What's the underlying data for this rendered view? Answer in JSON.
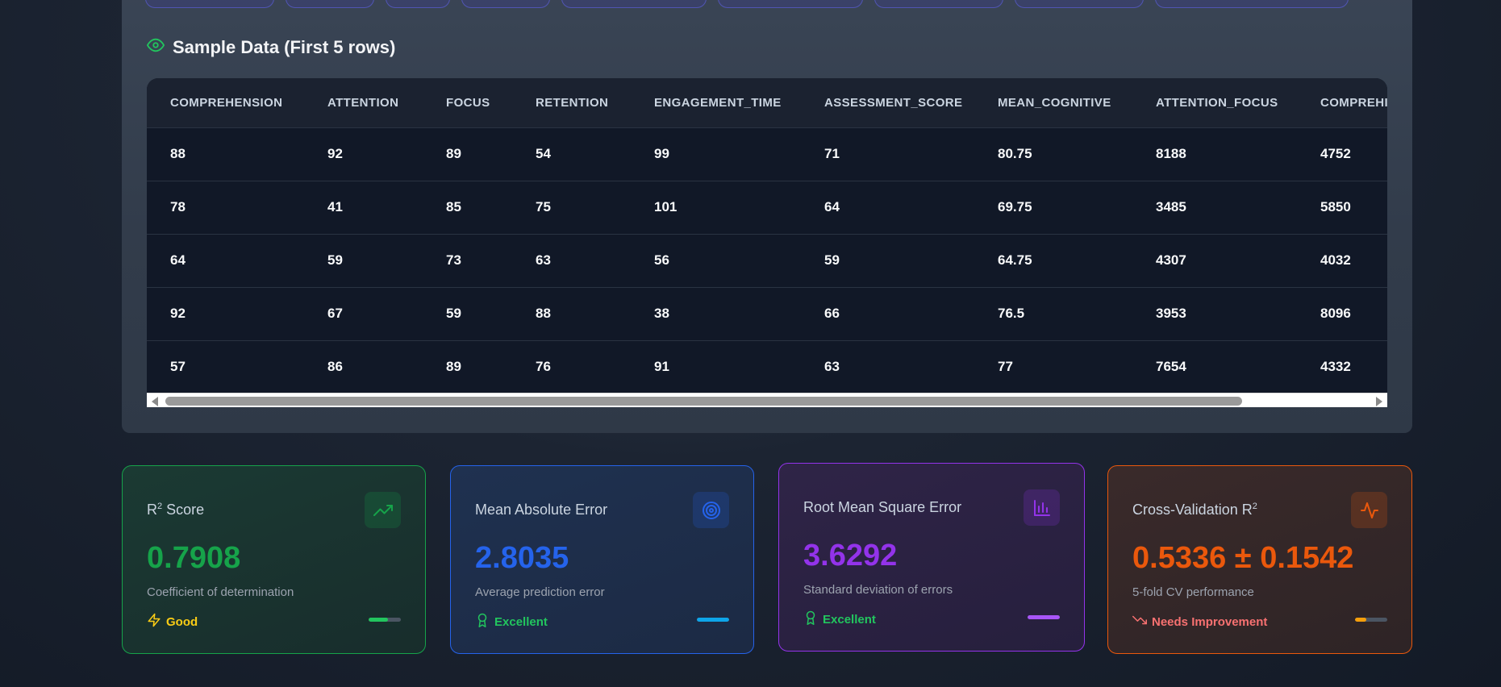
{
  "sample_section": {
    "title": "Sample Data (First 5 rows)",
    "icon": "eye-icon",
    "columns": [
      "COMPREHENSION",
      "ATTENTION",
      "FOCUS",
      "RETENTION",
      "ENGAGEMENT_TIME",
      "ASSESSMENT_SCORE",
      "MEAN_COGNITIVE",
      "ATTENTION_FOCUS",
      "COMPREHI"
    ],
    "rows": [
      [
        "88",
        "92",
        "89",
        "54",
        "99",
        "71",
        "80.75",
        "8188",
        "4752"
      ],
      [
        "78",
        "41",
        "85",
        "75",
        "101",
        "64",
        "69.75",
        "3485",
        "5850"
      ],
      [
        "64",
        "59",
        "73",
        "63",
        "56",
        "59",
        "64.75",
        "4307",
        "4032"
      ],
      [
        "92",
        "67",
        "59",
        "88",
        "38",
        "66",
        "76.5",
        "3953",
        "8096"
      ],
      [
        "57",
        "86",
        "89",
        "76",
        "91",
        "63",
        "77",
        "7654",
        "4332"
      ]
    ]
  },
  "metrics": [
    {
      "label": "R",
      "label_sup": "2",
      "label_suffix": " Score",
      "value": "0.7908",
      "sub": "Coefficient of determination",
      "status": "Good",
      "status_icon": "lightning-icon",
      "icon": "trending-up-icon",
      "accent": "#16a34a",
      "status_color": "#facc15",
      "level": 0.6
    },
    {
      "label": "Mean Absolute Error",
      "label_sup": "",
      "label_suffix": "",
      "value": "2.8035",
      "sub": "Average prediction error",
      "status": "Excellent",
      "status_icon": "award-icon",
      "icon": "target-icon",
      "accent": "#2563eb",
      "status_color": "#22c55e",
      "level": 1.0
    },
    {
      "label": "Root Mean Square Error",
      "label_sup": "",
      "label_suffix": "",
      "value": "3.6292",
      "sub": "Standard deviation of errors",
      "status": "Excellent",
      "status_icon": "award-icon",
      "icon": "bar-chart-icon",
      "accent": "#9333ea",
      "status_color": "#22c55e",
      "level": 1.0
    },
    {
      "label": "Cross-Validation R",
      "label_sup": "2",
      "label_suffix": "",
      "value": "0.5336 ± 0.1542",
      "sub": "5-fold CV performance",
      "status": "Needs Improvement",
      "status_icon": "trending-down-icon",
      "icon": "activity-icon",
      "accent": "#ea580c",
      "status_color": "#f87171",
      "level": 0.35
    }
  ]
}
